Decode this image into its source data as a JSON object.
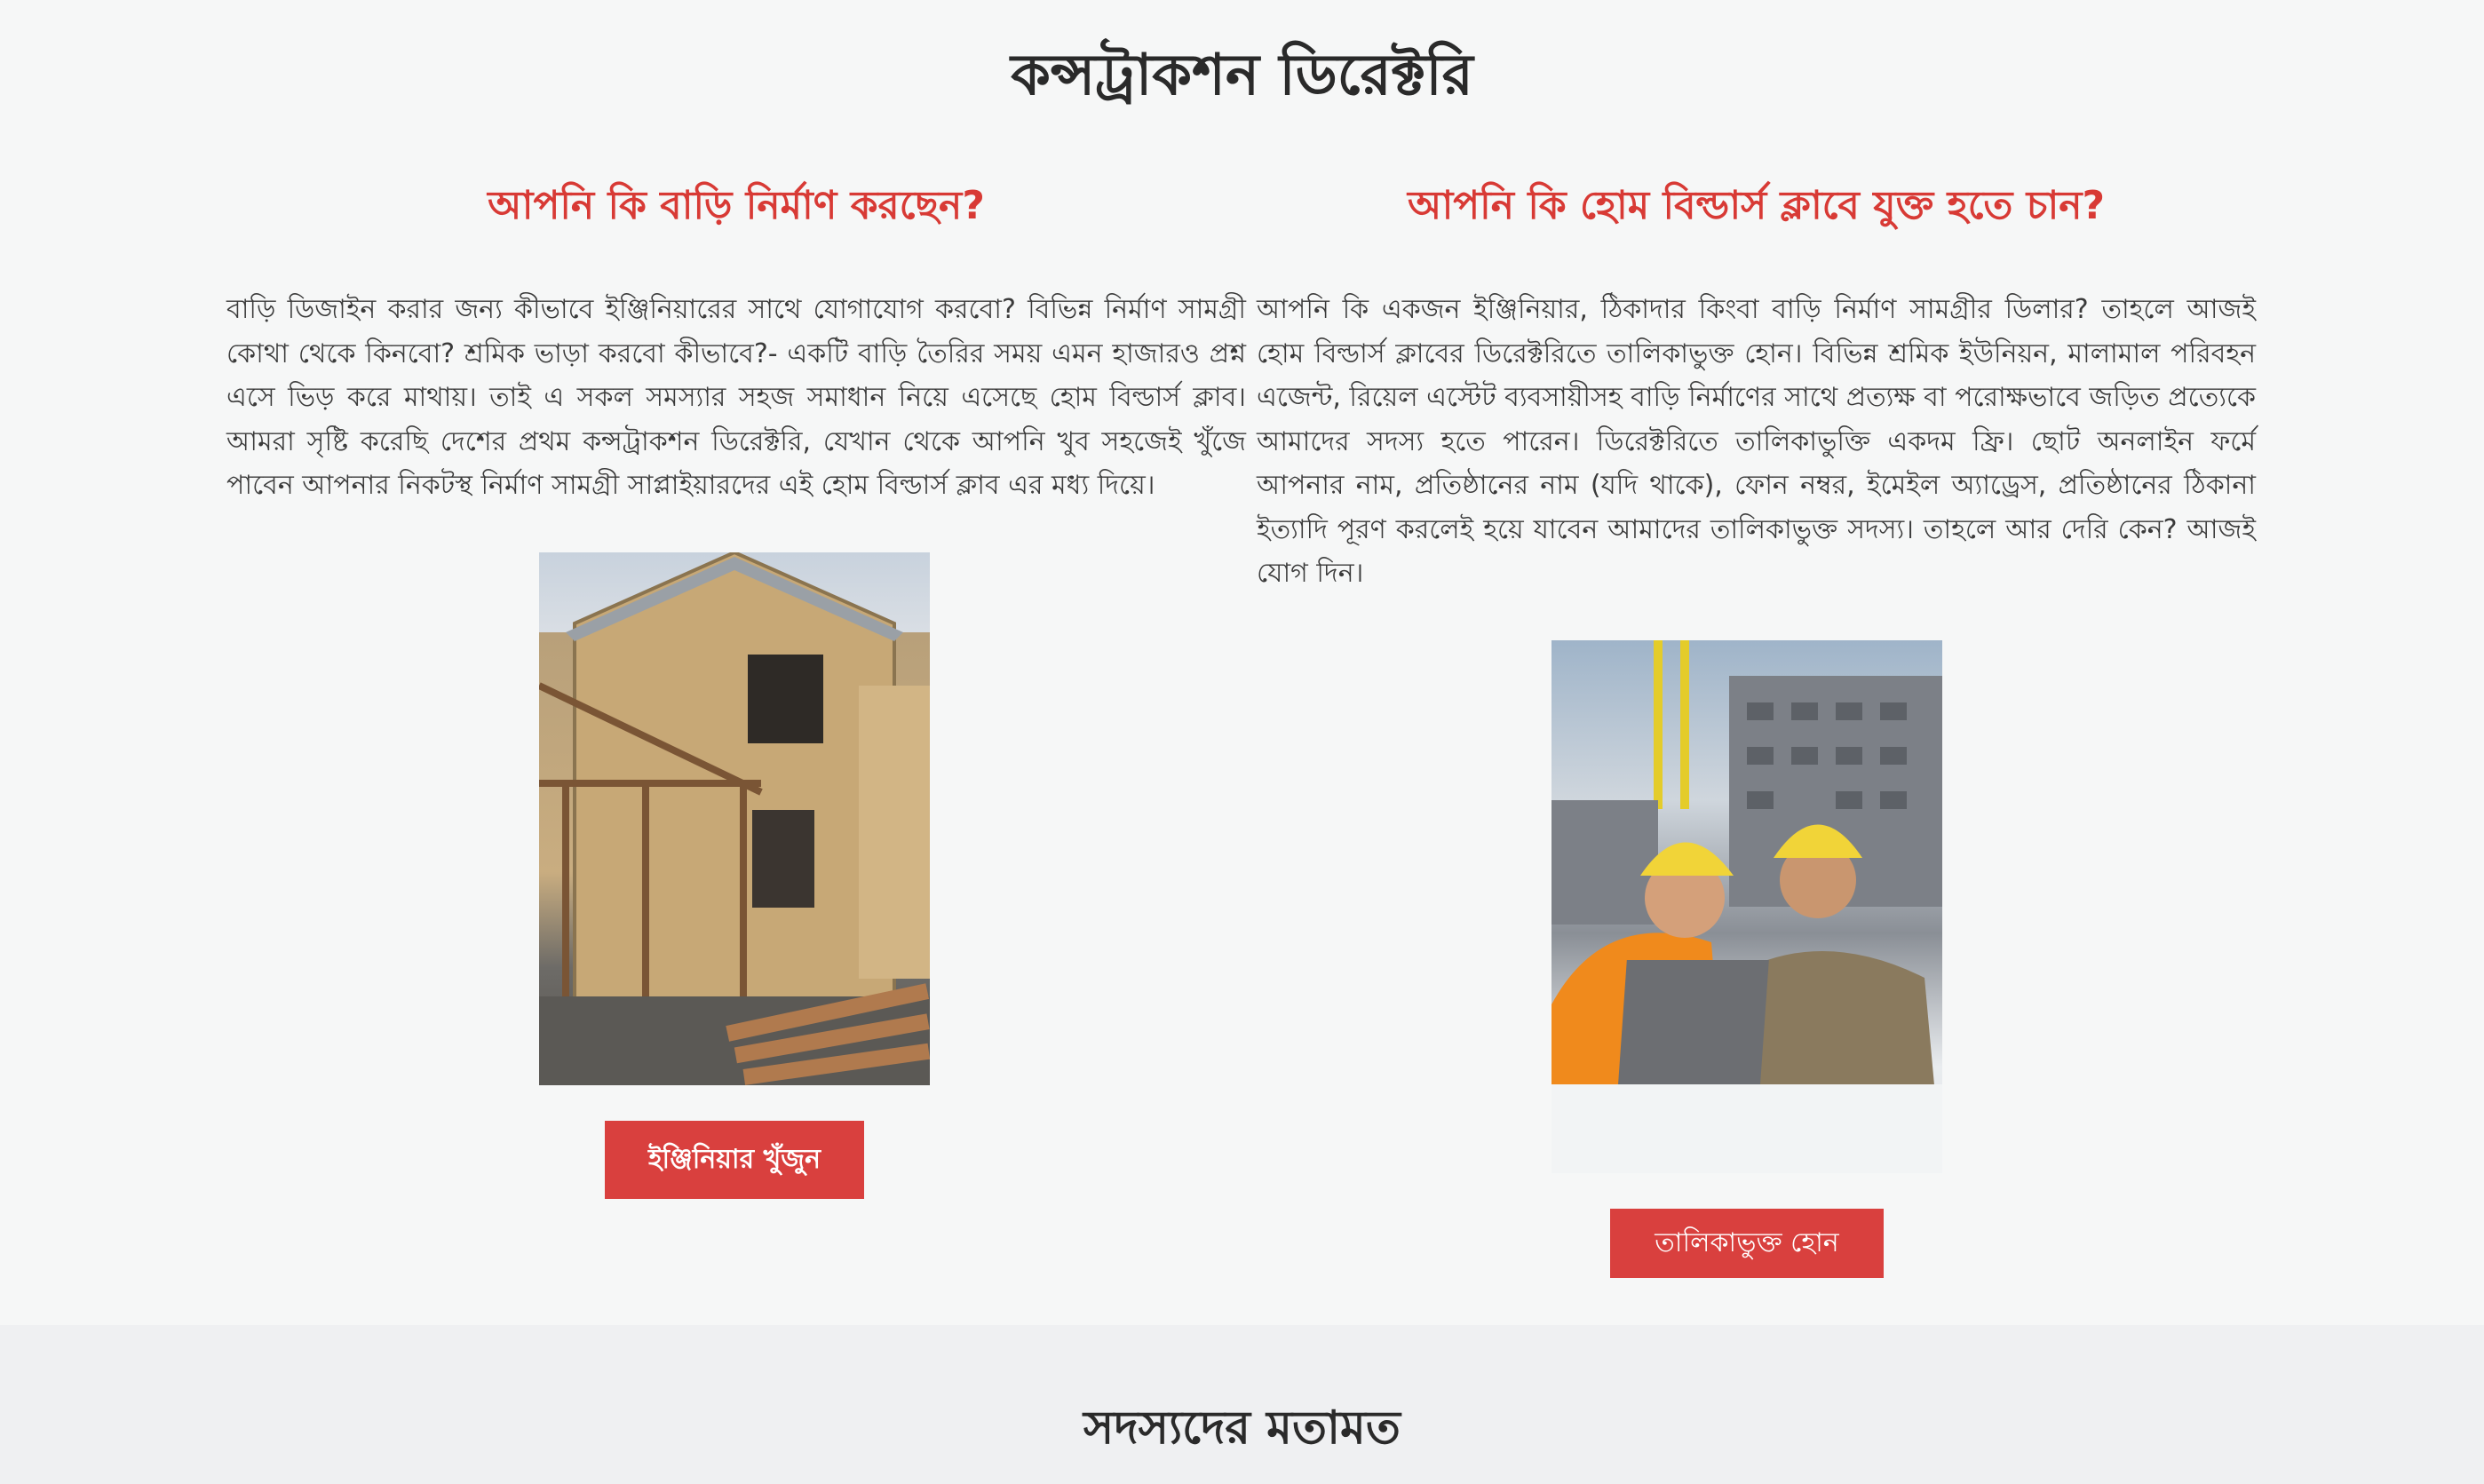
{
  "page": {
    "title": "কন্সট্রাকশন ডিরেক্টরি"
  },
  "left": {
    "heading": "আপনি কি বাড়ি নির্মাণ করছেন?",
    "body": "বাড়ি ডিজাইন করার জন্য কীভাবে ইঞ্জিনিয়ারের সাথে যোগাযোগ করবো? বিভিন্ন নির্মাণ সামগ্রী কোথা থেকে কিনবো? শ্রমিক ভাড়া করবো কীভাবে?- একটি বাড়ি তৈরির সময় এমন হাজারও প্রশ্ন এসে ভিড় করে মাথায়। তাই এ সকল সমস্যার সহজ সমাধান নিয়ে এসেছে হোম বিল্ডার্স ক্লাব। আমরা সৃষ্টি করেছি দেশের প্রথম কন্সট্রাকশন ডিরেক্টরি, যেখান থেকে আপনি খুব সহজেই খুঁজে পাবেন আপনার নিকটস্থ নির্মাণ সামগ্রী সাপ্লাইয়ারদের এই হোম বিল্ডার্স ক্লাব এর মধ্য দিয়ে।",
    "button_label": "ইঞ্জিনিয়ার খুঁজুন"
  },
  "right": {
    "heading": "আপনি কি হোম বিল্ডার্স ক্লাবে যুক্ত হতে চান?",
    "body": "আপনি কি একজন ইঞ্জিনিয়ার, ঠিকাদার কিংবা বাড়ি নির্মাণ সামগ্রীর ডিলার? তাহলে আজই হোম বিল্ডার্স ক্লাবের ডিরেক্টরিতে তালিকাভুক্ত হোন। বিভিন্ন শ্রমিক ইউনিয়ন, মালামাল পরিবহন এজেন্ট, রিয়েল এস্টেট ব্যবসায়ীসহ বাড়ি নির্মাণের সাথে প্রত্যক্ষ বা পরোক্ষভাবে জড়িত প্রত্যেকে আমাদের সদস্য হতে পারেন। ডিরেক্টরিতে তালিকাভুক্তি একদম ফ্রি। ছোট অনলাইন ফর্মে আপনার নাম, প্রতিষ্ঠানের নাম (যদি থাকে), ফোন নম্বর, ইমেইল অ্যাড্রেস, প্রতিষ্ঠানের ঠিকানা ইত্যাদি পূরণ করলেই হয়ে যাবেন আমাদের তালিকাভুক্ত সদস্য। তাহলে আর দেরি কেন? আজই যোগ দিন।",
    "button_label": "তালিকাভুক্ত হোন"
  },
  "testimonials": {
    "title": "সদস্যদের মতামত"
  },
  "colors": {
    "accent": "#d83a35",
    "button": "#d9403e",
    "background": "#f6f7f7",
    "band": "#eff0f2"
  }
}
